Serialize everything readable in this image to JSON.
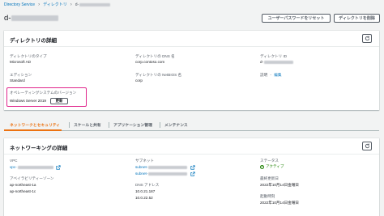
{
  "breadcrumb": {
    "home": "Directory Service",
    "section": "ディレクトリ",
    "current": "d-"
  },
  "header": {
    "title_prefix": "d-",
    "reset_button": "ユーザーパスワードをリセット",
    "delete_button": "ディレクトリを削除"
  },
  "details": {
    "title": "ディレクトリの詳細",
    "type_label": "ディレクトリのタイプ",
    "type_value": "Microsoft AD",
    "edition_label": "エディション",
    "edition_value": "Standard",
    "os_label": "オペレーティングシステムのバージョン",
    "os_value": "Windows Server 2019",
    "update_button": "更新",
    "dns_name_label": "ディレクトリの DNS 名",
    "dns_name_value": "corp.contoso.com",
    "netbios_label": "ディレクトリの NetBIOS 名",
    "netbios_value": "corp",
    "id_label": "ディレクトリ ID",
    "id_value": "d-",
    "description_label": "説明",
    "description_edit": "編集"
  },
  "tabs": [
    {
      "label": "ネットワークとセキュリティ",
      "active": true
    },
    {
      "label": "スケールと共有",
      "active": false
    },
    {
      "label": "アプリケーション管理",
      "active": false
    },
    {
      "label": "メンテナンス",
      "active": false
    }
  ],
  "networking": {
    "title": "ネットワーキングの詳細",
    "vpc_label": "VPC",
    "vpc_value": "vpc-",
    "az_label": "アベイラビリティーゾーン",
    "az_values": [
      "ap-northeast-1a",
      "ap-northeast-1c"
    ],
    "subnet_label": "サブネット",
    "subnet_values": [
      "subnet-",
      "subnet-"
    ],
    "dns_label": "DNS アドレス",
    "dns_values": [
      "10.0.21.187",
      "10.0.22.52"
    ],
    "status_label": "ステータス",
    "status_value": "アクティブ",
    "updated_label": "最終更新日",
    "updated_value": "2022年10月14日金曜日",
    "launched_label": "起動時刻",
    "launched_value": "2022年10月14日金曜日"
  },
  "colors": {
    "link": "#0073bb",
    "active_tab": "#ec7211",
    "highlight": "#e0268c",
    "status": "#1d8102"
  }
}
